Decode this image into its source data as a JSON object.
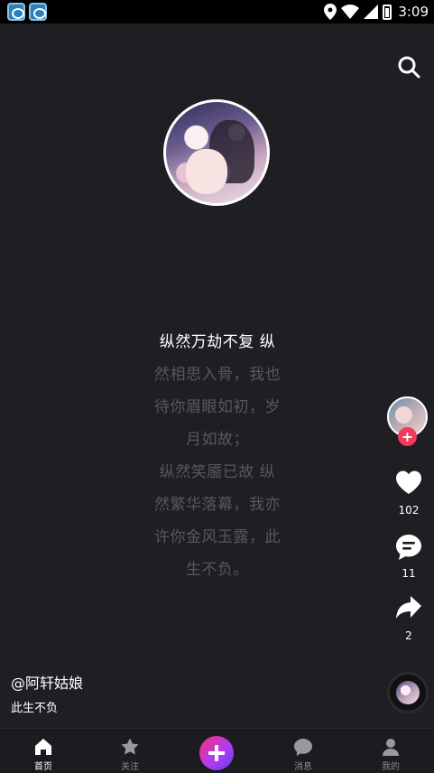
{
  "status_bar": {
    "time": "3:09"
  },
  "lyrics": [
    "纵然万劫不复 纵",
    "然相思入骨，我也",
    "待你眉眼如初，岁",
    "月如故；",
    "纵然笑靥已故 纵",
    "然繁华落幕，我亦",
    "许你金风玉露，此",
    "生不负。"
  ],
  "actions": {
    "like_count": "102",
    "comment_count": "11",
    "share_count": "2"
  },
  "post": {
    "author": "@阿轩姑娘",
    "description": "此生不负"
  },
  "nav": {
    "home": "首页",
    "follow": "关注",
    "messages": "消息",
    "me": "我的"
  },
  "colors": {
    "background": "#1f1e23",
    "accent_red": "#f33a5b",
    "plus_gradient_start": "#ff2d78",
    "plus_gradient_end": "#6a3cf0",
    "lyric_inactive": "#58575d"
  }
}
